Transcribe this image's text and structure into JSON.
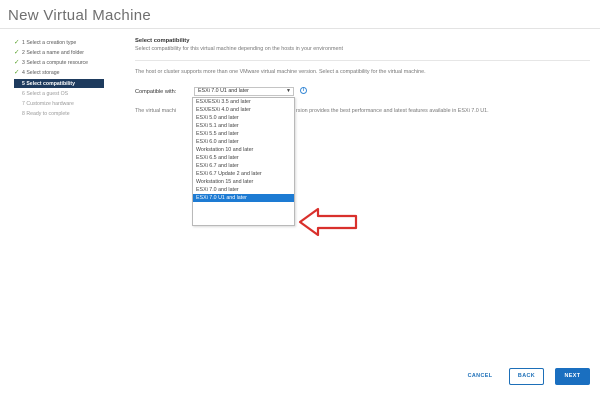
{
  "window": {
    "title": "New Virtual Machine"
  },
  "steps": [
    {
      "label": "1 Select a creation type",
      "state": "done"
    },
    {
      "label": "2 Select a name and folder",
      "state": "done"
    },
    {
      "label": "3 Select a compute resource",
      "state": "done"
    },
    {
      "label": "4 Select storage",
      "state": "done"
    },
    {
      "label": "5 Select compatibility",
      "state": "current"
    },
    {
      "label": "6 Select a guest OS",
      "state": "todo"
    },
    {
      "label": "7 Customize hardware",
      "state": "todo"
    },
    {
      "label": "8 Ready to complete",
      "state": "todo"
    }
  ],
  "main": {
    "heading": "Select compatibility",
    "subheading": "Select compatibility for this virtual machine depending on the hosts in your environment",
    "description": "The host or cluster supports more than one VMware virtual machine version. Select a compatibility for the virtual machine.",
    "compat_label": "Compatible with:",
    "compat_value": "ESXi 7.0 U1 and later",
    "compat_note_start": "The virtual machi",
    "compat_note_end": "rsion provides the best performance and latest features available in ESXi 7.0 U1."
  },
  "dropdown": {
    "options": [
      "ESX/ESXi 3.5 and later",
      "ESX/ESXi 4.0 and later",
      "ESXi 5.0 and later",
      "ESXi 5.1 and later",
      "ESXi 5.5 and later",
      "ESXi 6.0 and later",
      "Workstation 10 and later",
      "ESXi 6.5 and later",
      "ESXi 6.7 and later",
      "ESXi 6.7 Update 2 and later",
      "Workstation 15 and later",
      "ESXi 7.0 and later",
      "ESXi 7.0 U1 and later"
    ],
    "selected_index": 12
  },
  "footer": {
    "cancel": "CANCEL",
    "back": "BACK",
    "next": "NEXT"
  },
  "colors": {
    "accent": "#1a6fc0",
    "current_step_bg": "#1e3b5e",
    "check_green": "#5aa02c",
    "arrow_red": "#d9302c"
  }
}
